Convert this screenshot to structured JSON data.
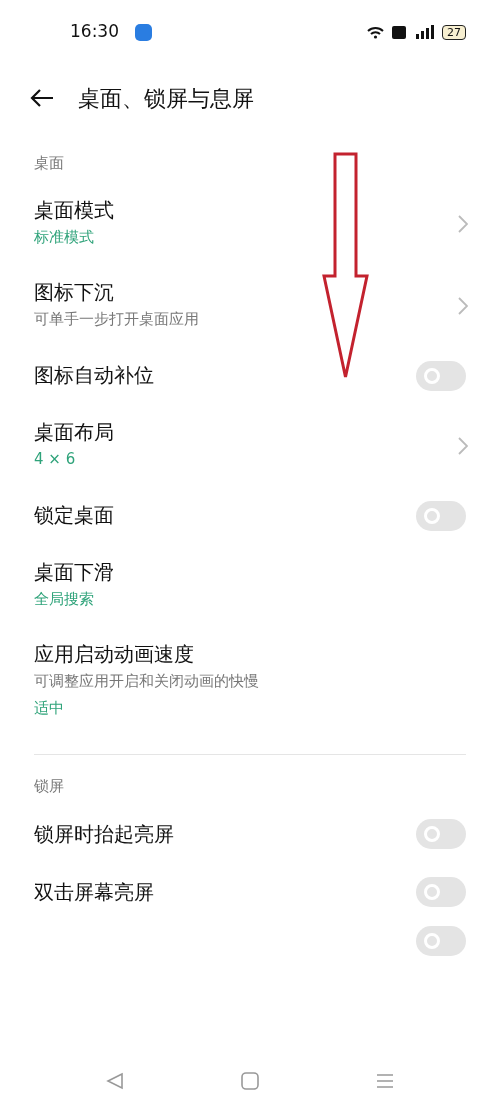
{
  "status_bar": {
    "time": "16:30",
    "battery": "27"
  },
  "header": {
    "title": "桌面、锁屏与息屏"
  },
  "sections": [
    {
      "label": "桌面",
      "items": [
        {
          "kind": "nav",
          "title": "桌面模式",
          "lines": [
            {
              "kind": "value",
              "text": "标准模式"
            }
          ]
        },
        {
          "kind": "nav",
          "title": "图标下沉",
          "lines": [
            {
              "kind": "hint",
              "text": "可单手一步打开桌面应用"
            }
          ]
        },
        {
          "kind": "toggle",
          "title": "图标自动补位",
          "on": false
        },
        {
          "kind": "nav",
          "title": "桌面布局",
          "lines": [
            {
              "kind": "value",
              "text": "4 × 6"
            }
          ]
        },
        {
          "kind": "toggle",
          "title": "锁定桌面",
          "on": false
        },
        {
          "kind": "plain",
          "title": "桌面下滑",
          "lines": [
            {
              "kind": "value",
              "text": "全局搜索"
            }
          ]
        },
        {
          "kind": "plain",
          "title": "应用启动动画速度",
          "lines": [
            {
              "kind": "hint",
              "text": "可调整应用开启和关闭动画的快慢"
            },
            {
              "kind": "value",
              "text": "适中"
            }
          ]
        }
      ]
    },
    {
      "label": "锁屏",
      "items": [
        {
          "kind": "toggle",
          "title": "锁屏时抬起亮屏",
          "on": false
        },
        {
          "kind": "toggle",
          "title": "双击屏幕亮屏",
          "on": false
        },
        {
          "kind": "toggle",
          "on": false
        }
      ]
    }
  ]
}
